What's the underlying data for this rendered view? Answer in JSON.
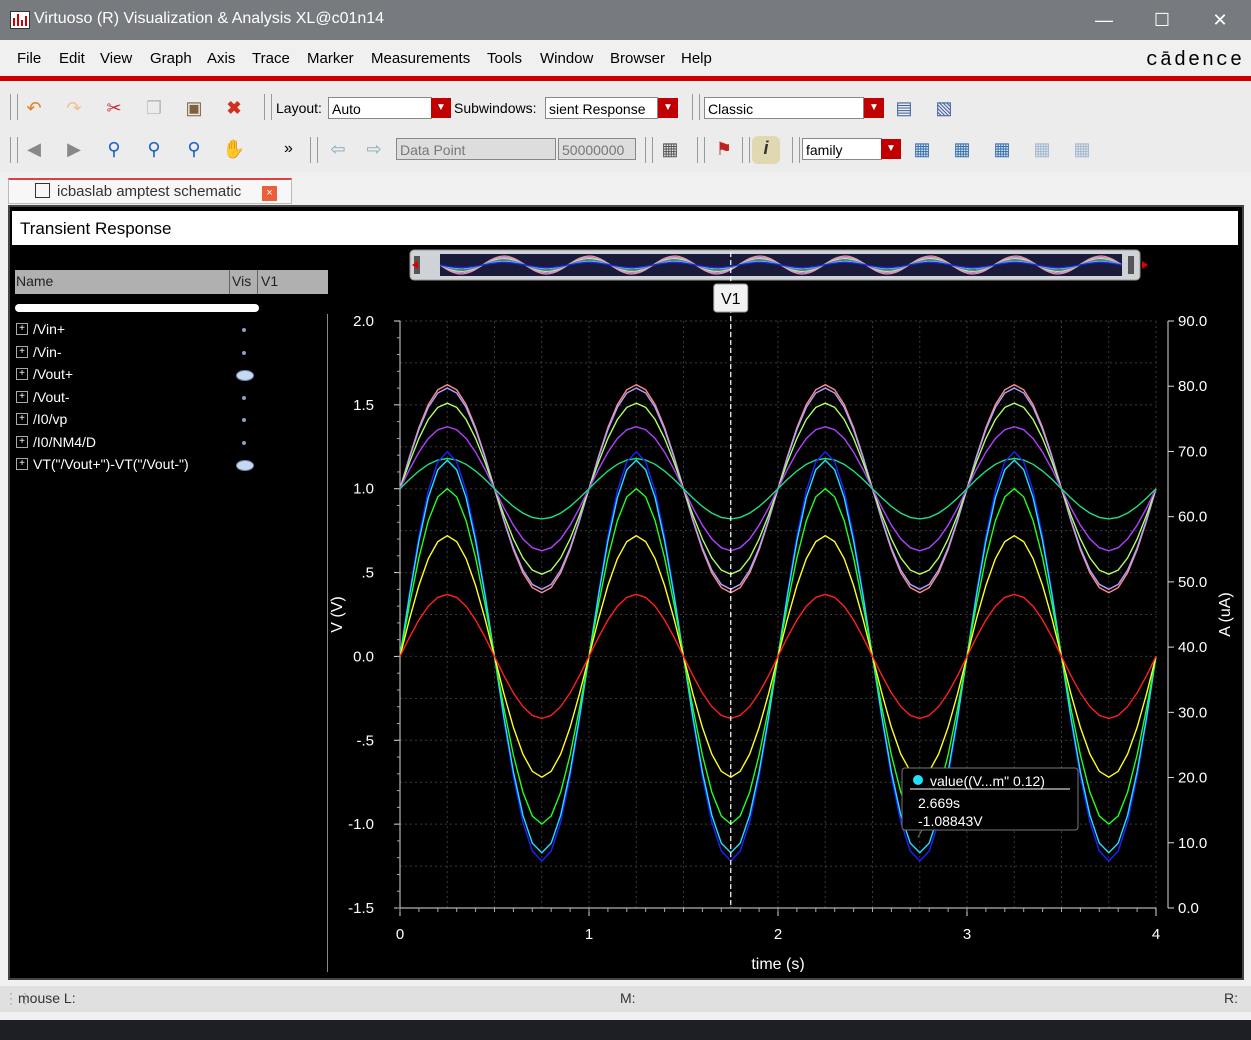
{
  "window": {
    "title": "Virtuoso (R) Visualization & Analysis XL@c01n14"
  },
  "menu": [
    "File",
    "Edit",
    "View",
    "Graph",
    "Axis",
    "Trace",
    "Marker",
    "Measurements",
    "Tools",
    "Window",
    "Browser",
    "Help"
  ],
  "brand": "cādence",
  "toolbar1": {
    "layout_label": "Layout:",
    "layout_value": "Auto",
    "subwindows_label": "Subwindows:",
    "subwindows_value": "sient Response",
    "style_value": "Classic"
  },
  "toolbar2": {
    "more": "»",
    "marker_type": "Data Point",
    "marker_value": "50000000",
    "family_value": "family"
  },
  "tab": {
    "label": "icbaslab amptest schematic",
    "close": "×"
  },
  "subwindow_title": "Transient Response",
  "browser": {
    "col_name": "Name",
    "col_vis": "Vis",
    "col_v1": "V1",
    "items": [
      {
        "expander": "+",
        "label": "/Vin+",
        "visible": false
      },
      {
        "expander": "+",
        "label": "/Vin-",
        "visible": false
      },
      {
        "expander": "+",
        "label": "/Vout+",
        "visible": true
      },
      {
        "expander": "+",
        "label": "/Vout-",
        "visible": false
      },
      {
        "expander": "+",
        "label": "/I0/vp",
        "visible": false
      },
      {
        "expander": "+",
        "label": "/I0/NM4/D",
        "visible": false
      },
      {
        "expander": "+",
        "label": "VT(\"/Vout+\")-VT(\"/Vout-\")",
        "visible": true
      }
    ]
  },
  "chart_data": {
    "type": "line",
    "xlabel": "time (s)",
    "ylabel": "V (V)",
    "y2label": "A (uA)",
    "xlim": [
      0,
      4
    ],
    "ylim": [
      -1.5,
      2.0
    ],
    "y2lim": [
      0.0,
      90.0
    ],
    "xticks": [
      "0",
      "1",
      "2",
      "3",
      "4"
    ],
    "yticks": [
      "2.0",
      "1.5",
      "1.0",
      ".5",
      "0.0",
      "-.5",
      "-1.0",
      "-1.5"
    ],
    "y2ticks": [
      "90.0",
      "80.0",
      "70.0",
      "60.0",
      "50.0",
      "40.0",
      "30.0",
      "20.0",
      "10.0",
      "0.0"
    ],
    "grid": true,
    "frequency_hz": 1,
    "series": [
      {
        "color": "#ff8c8c",
        "offset": 1.0,
        "amplitude": 0.62
      },
      {
        "color": "#b0a0ff",
        "offset": 1.0,
        "amplitude": 0.6
      },
      {
        "color": "#b0ff66",
        "offset": 1.0,
        "amplitude": 0.51
      },
      {
        "color": "#b040ff",
        "offset": 1.0,
        "amplitude": 0.37
      },
      {
        "color": "#20e080",
        "offset": 1.0,
        "amplitude": 0.18
      },
      {
        "color": "#2020ff",
        "offset": 0.0,
        "amplitude": 1.22
      },
      {
        "color": "#20e0ff",
        "offset": 0.0,
        "amplitude": 1.17
      },
      {
        "color": "#20ff20",
        "offset": 0.0,
        "amplitude": 1.0
      },
      {
        "color": "#ffff20",
        "offset": 0.0,
        "amplitude": 0.72
      },
      {
        "color": "#ff2020",
        "offset": 0.0,
        "amplitude": 0.37
      }
    ],
    "vertical_marker": {
      "label": "V1",
      "x": 1.75
    },
    "point_marker": {
      "label": "value((V...m\" 0.12)",
      "x_text": "2.669s",
      "y_text": "-1.08843V",
      "x": 2.74,
      "y": -1.08
    }
  },
  "status": {
    "left": "mouse L:",
    "middle": "M:",
    "right": "R:"
  }
}
